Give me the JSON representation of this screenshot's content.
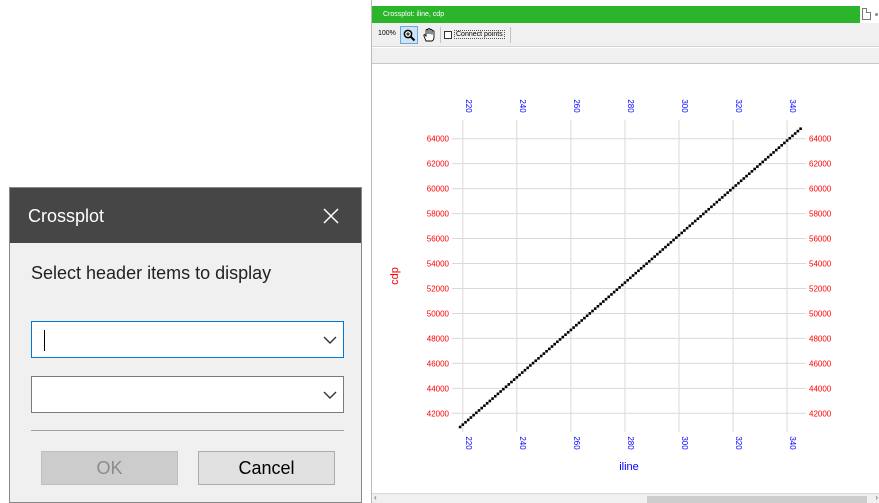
{
  "crossplot_window": {
    "title": "Crossplot: iline, cdp",
    "toolbar": {
      "zoom_level": "100%",
      "zoom_tool_icon": "magnifier-icon",
      "pan_tool_icon": "hand-icon",
      "connect_points_label": "Connect points",
      "connect_points_checked": false
    }
  },
  "chart_data": {
    "type": "scatter",
    "xlabel": "iline",
    "ylabel": "cdp",
    "xlim": [
      216,
      347
    ],
    "ylim": [
      40500,
      65500
    ],
    "x_ticks": [
      220,
      240,
      260,
      280,
      300,
      320,
      340
    ],
    "x_tick_labels": [
      "220",
      "240",
      "260",
      "280",
      "300",
      "320",
      "340"
    ],
    "y_ticks": [
      42000,
      44000,
      46000,
      48000,
      50000,
      52000,
      54000,
      56000,
      58000,
      60000,
      62000,
      64000
    ],
    "y_tick_labels": [
      "42000",
      "44000",
      "46000",
      "48000",
      "50000",
      "52000",
      "54000",
      "56000",
      "58000",
      "60000",
      "62000",
      "64000"
    ],
    "grid": true,
    "colors": {
      "x_axis": "#0000ff",
      "y_axis": "#ff0000",
      "points": "#000000"
    },
    "series": [
      {
        "x_start": 219,
        "x_end": 345,
        "x_step": 1,
        "y_start": 40900,
        "y_end": 64800
      }
    ]
  },
  "dialog": {
    "title": "Crossplot",
    "prompt": "Select header items to display",
    "combo1_value": "",
    "combo2_value": "",
    "ok_label": "OK",
    "cancel_label": "Cancel",
    "ok_enabled": false
  }
}
